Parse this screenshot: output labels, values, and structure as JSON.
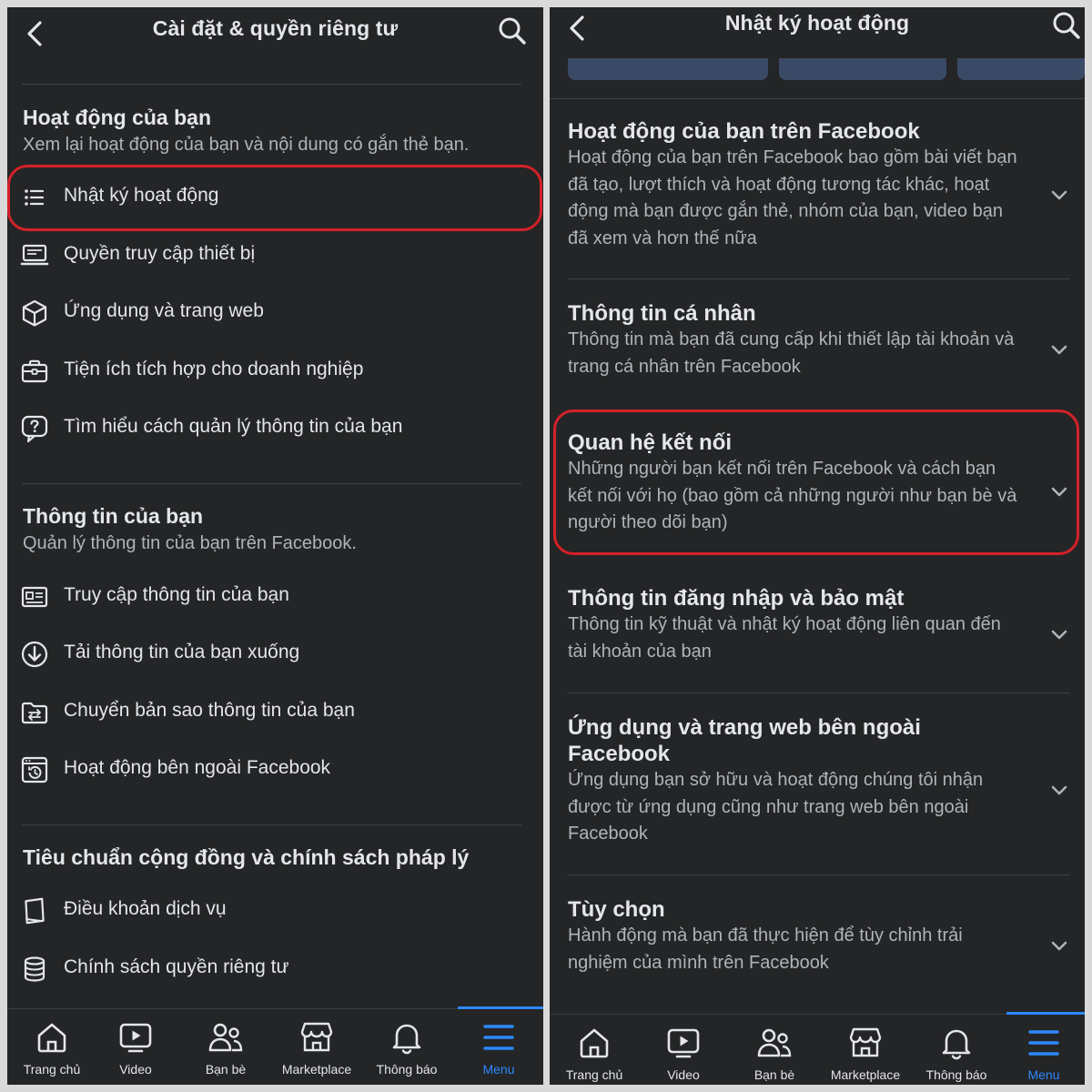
{
  "left": {
    "header": {
      "title": "Cài đặt & quyền riêng tư"
    },
    "sections": [
      {
        "title": "Hoạt động của bạn",
        "desc": "Xem lại hoạt động của bạn và nội dung có gắn thẻ bạn.",
        "items": [
          {
            "label": "Nhật ký hoạt động",
            "icon": "list-icon"
          },
          {
            "label": "Quyền truy cập thiết bị",
            "icon": "device-icon"
          },
          {
            "label": "Ứng dụng và trang web",
            "icon": "cube-icon"
          },
          {
            "label": "Tiện ích tích hợp cho doanh nghiệp",
            "icon": "briefcase-icon"
          },
          {
            "label": "Tìm hiểu cách quản lý thông tin của bạn",
            "icon": "help-bubble-icon"
          }
        ]
      },
      {
        "title": "Thông tin của bạn",
        "desc": "Quản lý thông tin của bạn trên Facebook.",
        "items": [
          {
            "label": "Truy cập thông tin của bạn",
            "icon": "id-card-icon"
          },
          {
            "label": "Tải thông tin của bạn xuống",
            "icon": "download-icon"
          },
          {
            "label": "Chuyển bản sao thông tin của bạn",
            "icon": "transfer-folder-icon"
          },
          {
            "label": "Hoạt động bên ngoài Facebook",
            "icon": "history-icon"
          }
        ]
      },
      {
        "title": "Tiêu chuẩn cộng đồng và chính sách pháp lý",
        "items": [
          {
            "label": "Điều khoản dịch vụ",
            "icon": "book-icon"
          },
          {
            "label": "Chính sách quyền riêng tư",
            "icon": "database-icon"
          }
        ]
      }
    ]
  },
  "right": {
    "header": {
      "title": "Nhật ký hoạt động"
    },
    "cards": [
      {
        "title": "Hoạt động của bạn trên Facebook",
        "desc": "Hoạt động của bạn trên Facebook bao gồm bài viết bạn đã tạo, lượt thích và hoạt động tương tác khác, hoạt động mà bạn được gắn thẻ, nhóm của bạn, video bạn đã xem và hơn thế nữa"
      },
      {
        "title": "Thông tin cá nhân",
        "desc": "Thông tin mà bạn đã cung cấp khi thiết lập tài khoản và trang cá nhân trên Facebook"
      },
      {
        "title": "Quan hệ kết nối",
        "desc": "Những người bạn kết nối trên Facebook và cách bạn kết nối với họ (bao gồm cả những người như bạn bè và người theo dõi bạn)"
      },
      {
        "title": "Thông tin đăng nhập và bảo mật",
        "desc": "Thông tin kỹ thuật và nhật ký hoạt động liên quan đến tài khoản của bạn"
      },
      {
        "title": "Ứng dụng và trang web bên ngoài Facebook",
        "desc": "Ứng dụng bạn sở hữu và hoạt động chúng tôi nhận được từ ứng dụng cũng như trang web bên ngoài Facebook"
      },
      {
        "title": "Tùy chọn",
        "desc": "Hành động mà bạn đã thực hiện để tùy chỉnh trải nghiệm của mình trên Facebook"
      }
    ]
  },
  "nav": {
    "tabs": [
      {
        "label": "Trang chủ",
        "icon": "home-icon"
      },
      {
        "label": "Video",
        "icon": "video-icon"
      },
      {
        "label": "Bạn bè",
        "icon": "friends-icon"
      },
      {
        "label": "Marketplace",
        "icon": "marketplace-icon"
      },
      {
        "label": "Thông báo",
        "icon": "bell-icon"
      },
      {
        "label": "Menu",
        "icon": "menu-icon"
      }
    ],
    "active": "Menu"
  },
  "colors": {
    "background": "#242526",
    "text": "#e4e6eb",
    "secondary": "#b0b3b8",
    "accent": "#2d88ff",
    "highlight": "#d42128"
  }
}
